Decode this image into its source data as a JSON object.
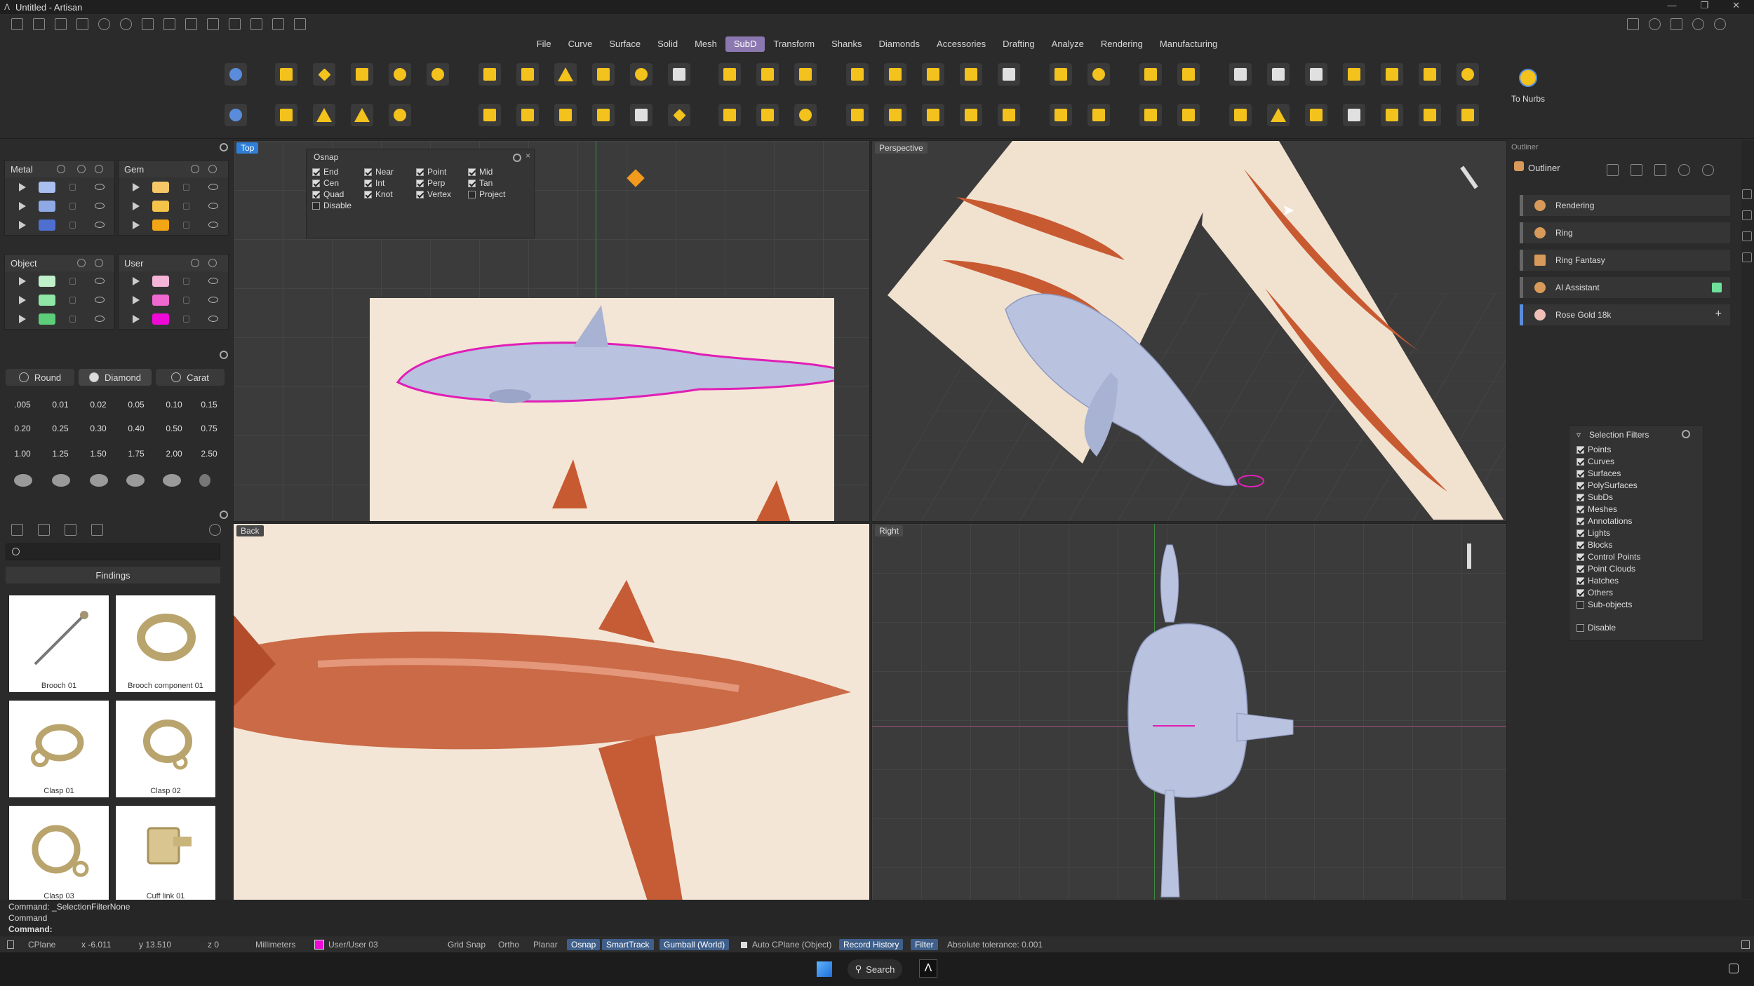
{
  "titlebar": {
    "title": "Untitled - Artisan"
  },
  "menu": {
    "tabs": [
      "File",
      "Curve",
      "Surface",
      "Solid",
      "Mesh",
      "SubD",
      "Transform",
      "Shanks",
      "Diamonds",
      "Accessories",
      "Drafting",
      "Analyze",
      "Rendering",
      "Manufacturing"
    ],
    "active": "SubD"
  },
  "ribbon": {
    "to_nurbs_label": "To Nurbs"
  },
  "layers": {
    "metal": {
      "label": "Metal",
      "colors": [
        "#a9bff0",
        "#8ea9e6",
        "#4f6fd0"
      ]
    },
    "gem": {
      "label": "Gem",
      "colors": [
        "#f5c767",
        "#f4c34a",
        "#f2a515"
      ]
    },
    "object": {
      "label": "Object",
      "colors": [
        "#bff0c9",
        "#8fe6a5",
        "#5ccd79"
      ]
    },
    "user": {
      "label": "User",
      "colors": [
        "#f4b4d8",
        "#ef68cf",
        "#ee09d7"
      ]
    }
  },
  "gem_tools": {
    "buttons": [
      "Round",
      "Diamond",
      "Carat"
    ],
    "sizes": [
      ".005",
      "0.01",
      "0.02",
      "0.05",
      "0.10",
      "0.15",
      "0.20",
      "0.25",
      "0.30",
      "0.40",
      "0.50",
      "0.75",
      "1.00",
      "1.25",
      "1.50",
      "1.75",
      "2.00",
      "2.50"
    ]
  },
  "findings": {
    "title": "Findings",
    "items": [
      "Brooch 01",
      "Brooch component 01",
      "Clasp 01",
      "Clasp 02",
      "Clasp 03",
      "Cuff link 01"
    ]
  },
  "viewports": {
    "top": "Top",
    "perspective": "Perspective",
    "back": "Back",
    "right": "Right"
  },
  "osnap": {
    "title": "Osnap",
    "options": [
      {
        "label": "End",
        "checked": true
      },
      {
        "label": "Near",
        "checked": true
      },
      {
        "label": "Point",
        "checked": true
      },
      {
        "label": "Mid",
        "checked": true
      },
      {
        "label": "Cen",
        "checked": true
      },
      {
        "label": "Int",
        "checked": true
      },
      {
        "label": "Perp",
        "checked": true
      },
      {
        "label": "Tan",
        "checked": true
      },
      {
        "label": "Quad",
        "checked": true
      },
      {
        "label": "Knot",
        "checked": true
      },
      {
        "label": "Vertex",
        "checked": true
      },
      {
        "label": "Project",
        "checked": false
      },
      {
        "label": "Disable",
        "checked": false
      }
    ]
  },
  "outliner": {
    "panel_title": "Outliner",
    "title": "Outliner",
    "items": [
      "Rendering",
      "Ring",
      "Ring Fantasy",
      "AI Assistant",
      "Rose Gold 18k"
    ]
  },
  "selection_filters": {
    "title": "Selection Filters",
    "items": [
      {
        "label": "Points",
        "checked": true
      },
      {
        "label": "Curves",
        "checked": true
      },
      {
        "label": "Surfaces",
        "checked": true
      },
      {
        "label": "PolySurfaces",
        "checked": true
      },
      {
        "label": "SubDs",
        "checked": true
      },
      {
        "label": "Meshes",
        "checked": true
      },
      {
        "label": "Annotations",
        "checked": true
      },
      {
        "label": "Lights",
        "checked": true
      },
      {
        "label": "Blocks",
        "checked": true
      },
      {
        "label": "Control Points",
        "checked": true
      },
      {
        "label": "Point Clouds",
        "checked": true
      },
      {
        "label": "Hatches",
        "checked": true
      },
      {
        "label": "Others",
        "checked": true
      },
      {
        "label": "Sub-objects",
        "checked": false
      }
    ],
    "disable": "Disable"
  },
  "command": {
    "history1": "Command: _SelectionFilterNone",
    "history2": "Command",
    "prompt": "Command:"
  },
  "status": {
    "cplane": "CPlane",
    "x": "x -6.011",
    "y": "y 13.510",
    "z": "z 0",
    "units": "Millimeters",
    "layer": "User/User 03",
    "grid_snap": "Grid Snap",
    "ortho": "Ortho",
    "planar": "Planar",
    "osnap": "Osnap",
    "smarttrack": "SmartTrack",
    "gumball": "Gumball (World)",
    "auto_cplane": "Auto CPlane (Object)",
    "record_history": "Record History",
    "filter": "Filter",
    "tolerance": "Absolute tolerance: 0.001"
  },
  "taskbar": {
    "search": "Search"
  }
}
